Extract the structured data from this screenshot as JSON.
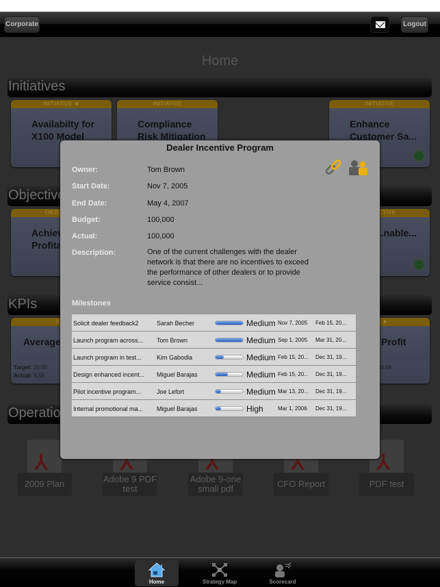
{
  "navbar": {
    "corporate_label": "Corporate",
    "mail_icon": "envelope-icon",
    "logout_label": "Logout"
  },
  "main": {
    "title": "Home",
    "sections": {
      "initiatives": "Initiatives",
      "objectives": "Objectives",
      "kpis": "KPIs",
      "operations": "Operations"
    },
    "initiative_cards": [
      {
        "header": "INITIATIVE ★",
        "title": "Availabilty for X100 Model"
      },
      {
        "header": "INITIATIVE",
        "title": "Compliance Risk Mitigation"
      },
      {
        "header": "INITIATIVE",
        "title": "Enhance Customer Sa...",
        "status_icon": "gauge-icon"
      }
    ],
    "objective_cards": [
      {
        "header": "OBJECTIVE",
        "title": "Achieve Profitability"
      },
      {
        "header": "OBJECTIVE",
        "title": "...nable...",
        "status_icon": "gauge-icon"
      }
    ],
    "kpi_cards": [
      {
        "header": "KPI",
        "title": "Average Fail",
        "target_label": "Target:",
        "target": "20.00",
        "actual_label": "Actual:",
        "actual": "5.55"
      },
      {
        "header": "KPI ★",
        "title": "Profit",
        "actual": "...090.56"
      }
    ],
    "documents": [
      {
        "label": "2009 Plan"
      },
      {
        "label": "Adobe 9 PDF test"
      },
      {
        "label": "Adobe 9-one small pdf"
      },
      {
        "label": "CFO Report"
      },
      {
        "label": "PDF test"
      }
    ]
  },
  "modal": {
    "title": "Dealer Incentive Program",
    "fields": {
      "owner_label": "Owner:",
      "owner": "Tom Brown",
      "start_label": "Start Date:",
      "start": "Nov 7, 2005",
      "end_label": "End Date:",
      "end": "May 4, 2007",
      "budget_label": "Budget:",
      "budget": "100,000",
      "actual_label": "Actual:",
      "actual": "100,000",
      "description_label": "Description:",
      "description": "One of the current challenges with the dealer network is that there are no incentives to exceed the performance of other dealers or to provide service consist..."
    },
    "milestones_label": "Milestones",
    "milestones": [
      {
        "name": "Solicit dealer feedback2",
        "owner": "Sarah Becher",
        "progress": 100,
        "priority": "Medium",
        "start": "Nov 7, 2005",
        "end": "Feb 15, 20..."
      },
      {
        "name": "Launch program across...",
        "owner": "Tom Brown",
        "progress": 100,
        "priority": "Medium",
        "start": "Sep 1, 2005",
        "end": "Mar 31, 20..."
      },
      {
        "name": "Launch program in test...",
        "owner": "Kim Gabodla",
        "progress": 30,
        "priority": "Medium",
        "start": "Feb 15, 20...",
        "end": "Dec 31, 19..."
      },
      {
        "name": "Design enhanced incent...",
        "owner": "Miguel Barajas",
        "progress": 45,
        "priority": "Medium",
        "start": "Feb 15, 20...",
        "end": "Dec 31, 19..."
      },
      {
        "name": "Pilot incentive program...",
        "owner": "Joe Lefort",
        "progress": 20,
        "priority": "Medium",
        "start": "Mar 13, 20...",
        "end": "Dec 31, 19..."
      },
      {
        "name": "Internal promotional ma...",
        "owner": "Miguel Barajas",
        "progress": 20,
        "priority": "High",
        "start": "Mar 1, 2006",
        "end": "Dec 31, 19..."
      }
    ]
  },
  "tabbar": {
    "tabs": [
      {
        "label": "Home",
        "icon": "home-icon",
        "active": true
      },
      {
        "label": "Strategy Map",
        "icon": "strategy-map-icon",
        "active": false
      },
      {
        "label": "Scorecard",
        "icon": "scorecard-icon",
        "active": false
      }
    ]
  },
  "colors": {
    "card_header": "#7a5d08",
    "accent_blue": "#2a5fc0",
    "modal_bg": "#9d9d9d",
    "link_icon_gold": "#e8b010"
  }
}
